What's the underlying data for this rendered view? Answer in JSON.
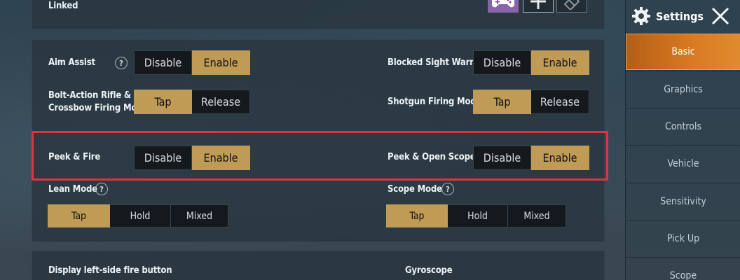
{
  "top_panel": {
    "label": "Linked"
  },
  "rows": {
    "aim_assist": {
      "label": "Aim Assist",
      "options": [
        "Disable",
        "Enable"
      ]
    },
    "blocked_sight": {
      "label": "Blocked Sight Warning",
      "options": [
        "Disable",
        "Enable"
      ]
    },
    "bolt_action": {
      "label_line1": "Bolt-Action Rifle &",
      "label_line2": "Crossbow Firing Mode",
      "options": [
        "Tap",
        "Release"
      ]
    },
    "shotgun": {
      "label": "Shotgun Firing Mode",
      "options": [
        "Tap",
        "Release"
      ]
    },
    "peek_fire": {
      "label": "Peek & Fire",
      "options": [
        "Disable",
        "Enable"
      ]
    },
    "peek_scope": {
      "label": "Peek & Open Scope",
      "options": [
        "Disable",
        "Enable"
      ]
    },
    "lean_mode": {
      "label": "Lean Mode",
      "options": [
        "Tap",
        "Hold",
        "Mixed"
      ]
    },
    "scope_mode": {
      "label": "Scope Mode",
      "options": [
        "Tap",
        "Hold",
        "Mixed"
      ]
    }
  },
  "bottom_panel": {
    "left_label": "Display left-side fire button",
    "right_label": "Gyroscope"
  },
  "help_glyph": "?",
  "sidebar": {
    "title": "Settings",
    "items": [
      "Basic",
      "Graphics",
      "Controls",
      "Vehicle",
      "Sensitivity",
      "Pick Up",
      "Scope"
    ],
    "active": "Basic"
  },
  "colors": {
    "selected": "#c09b55",
    "highlight": "#e0323f",
    "active_tab": "#d97b22"
  },
  "icons": [
    "gamepad-icon",
    "plus-icon",
    "eraser-icon",
    "gear-icon",
    "close-icon"
  ]
}
